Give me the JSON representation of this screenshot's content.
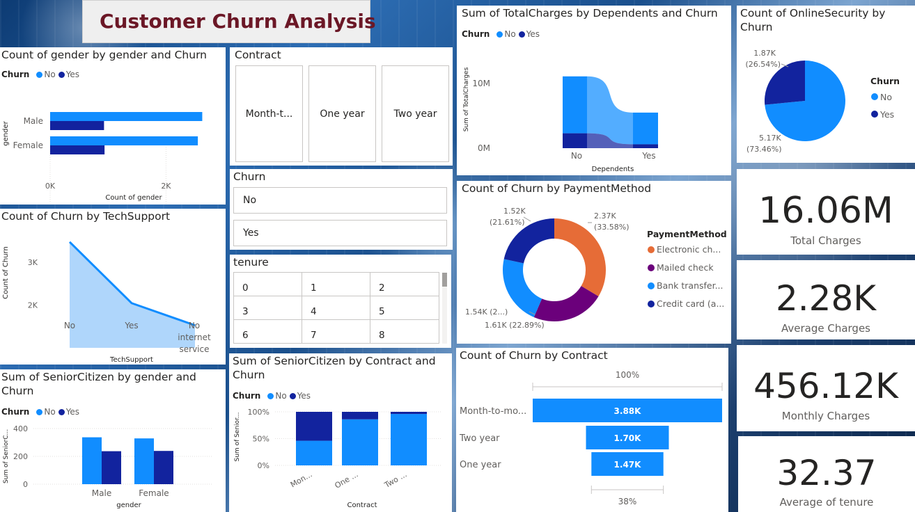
{
  "dashboard_title": "Customer Churn Analysis",
  "colors": {
    "no": "#118dff",
    "yes": "#12239e",
    "electronic": "#e66c37",
    "mailed": "#6b007b",
    "bank": "#118dff",
    "credit": "#12239e",
    "area": "#a6d1fb",
    "title": "#6b1726"
  },
  "gender_chart": {
    "title": "Count of gender by gender and Churn",
    "legend_title": "Churn",
    "legend_no": "No",
    "legend_yes": "Yes",
    "ylabel": "gender",
    "xlabel": "Count of gender",
    "x_ticks": [
      "0K",
      "2K"
    ],
    "chart_data": {
      "type": "bar",
      "categories": [
        "Male",
        "Female"
      ],
      "series": [
        {
          "name": "No",
          "values": [
            2625,
            2549
          ]
        },
        {
          "name": "Yes",
          "values": [
            930,
            939
          ]
        }
      ],
      "xlim": [
        0,
        2800
      ]
    }
  },
  "techsupport_chart": {
    "title": "Count of Churn by TechSupport",
    "ylabel": "Count of Churn",
    "xlabel": "TechSupport",
    "y_ticks": [
      "3K",
      "2K"
    ],
    "x_labels": [
      "No",
      "Yes",
      "No internet service"
    ],
    "chart_data": {
      "type": "area",
      "categories": [
        "No",
        "Yes",
        "No internet service"
      ],
      "values": [
        3473,
        2044,
        1526
      ],
      "ylim": [
        1000,
        3600
      ]
    }
  },
  "senior_gender_chart": {
    "title": "Sum of SeniorCitizen by gender and Churn",
    "legend_title": "Churn",
    "legend_no": "No",
    "legend_yes": "Yes",
    "ylabel": "Sum of SeniorC...",
    "xlabel": "gender",
    "y_ticks": [
      "400",
      "200",
      "0"
    ],
    "chart_data": {
      "type": "bar",
      "categories": [
        "Male",
        "Female"
      ],
      "series": [
        {
          "name": "No",
          "values": [
            337,
            329
          ]
        },
        {
          "name": "Yes",
          "values": [
            237,
            239
          ]
        }
      ],
      "ylim": [
        0,
        400
      ]
    }
  },
  "contract_slicer": {
    "title": "Contract",
    "options": [
      "Month-t...",
      "One year",
      "Two year"
    ]
  },
  "churn_slicer": {
    "title": "Churn",
    "options": [
      "No",
      "Yes"
    ]
  },
  "tenure_slicer": {
    "title": "tenure",
    "cells": [
      "0",
      "1",
      "2",
      "3",
      "4",
      "5",
      "6",
      "7",
      "8"
    ]
  },
  "senior_contract_chart": {
    "title": "Sum of SeniorCitizen by Contract and Churn",
    "legend_title": "Churn",
    "legend_no": "No",
    "legend_yes": "Yes",
    "ylabel": "Sum of Senior...",
    "xlabel": "Contract",
    "y_ticks": [
      "100%",
      "50%",
      "0%"
    ],
    "x_labels": [
      "Mon...",
      "One ...",
      "Two ..."
    ],
    "chart_data": {
      "type": "bar",
      "categories": [
        "Mon...",
        "One ...",
        "Two ..."
      ],
      "series": [
        {
          "name": "No",
          "values": [
            46,
            86,
            96
          ]
        },
        {
          "name": "Yes",
          "values": [
            54,
            14,
            4
          ]
        }
      ],
      "ylim": [
        0,
        100
      ]
    }
  },
  "totalcharges_chart": {
    "title": "Sum of TotalCharges by Dependents and Churn",
    "legend_title": "Churn",
    "legend_no": "No",
    "legend_yes": "Yes",
    "ylabel": "Sum of TotalCharges",
    "xlabel": "Dependents",
    "y_ticks": [
      "10M",
      "0M"
    ],
    "chart_data": {
      "type": "bar",
      "categories": [
        "No",
        "Yes"
      ],
      "series": [
        {
          "name": "No",
          "values": [
            8.8,
            4.9
          ]
        },
        {
          "name": "Yes",
          "values": [
            2.3,
            0.6
          ]
        }
      ],
      "ylim": [
        0,
        13
      ]
    }
  },
  "payment_chart": {
    "title": "Count of Churn by PaymentMethod",
    "legend_title": "PaymentMethod",
    "legend_items": [
      "Electronic ch...",
      "Mailed check",
      "Bank transfer...",
      "Credit card (a..."
    ],
    "slice_labels": [
      "2.37K",
      "(33.58%)",
      "1.61K (22.89%)",
      "1.54K (2...)",
      "1.52K",
      "(21.61%)"
    ],
    "chart_data": {
      "type": "pie",
      "categories": [
        "Electronic ch...",
        "Mailed check",
        "Bank transfer...",
        "Credit card (a..."
      ],
      "values": [
        2365,
        1612,
        1544,
        1522
      ],
      "percent": [
        33.58,
        22.89,
        21.92,
        21.61
      ]
    }
  },
  "contract_funnel": {
    "title": "Count of Churn by Contract",
    "top_label": "100%",
    "bottom_label": "38%",
    "bar_labels": [
      "3.88K",
      "1.70K",
      "1.47K"
    ],
    "chart_data": {
      "type": "bar",
      "categories": [
        "Month-to-mo...",
        "Two year",
        "One year"
      ],
      "values": [
        3875,
        1695,
        1473
      ]
    }
  },
  "onlinesecurity_chart": {
    "title": "Count of OnlineSecurity by Churn",
    "legend_title": "Churn",
    "legend_no": "No",
    "legend_yes": "Yes",
    "slice_labels": [
      "1.87K",
      "(26.54%)",
      "5.17K",
      "(73.46%)"
    ],
    "chart_data": {
      "type": "pie",
      "categories": [
        "No",
        "Yes"
      ],
      "values": [
        5174,
        1869
      ],
      "percent": [
        73.46,
        26.54
      ]
    }
  },
  "kpis": [
    {
      "value": "16.06M",
      "label": "Total Charges"
    },
    {
      "value": "2.28K",
      "label": "Average Charges"
    },
    {
      "value": "456.12K",
      "label": "Monthly Charges"
    },
    {
      "value": "32.37",
      "label": "Average of tenure"
    }
  ]
}
